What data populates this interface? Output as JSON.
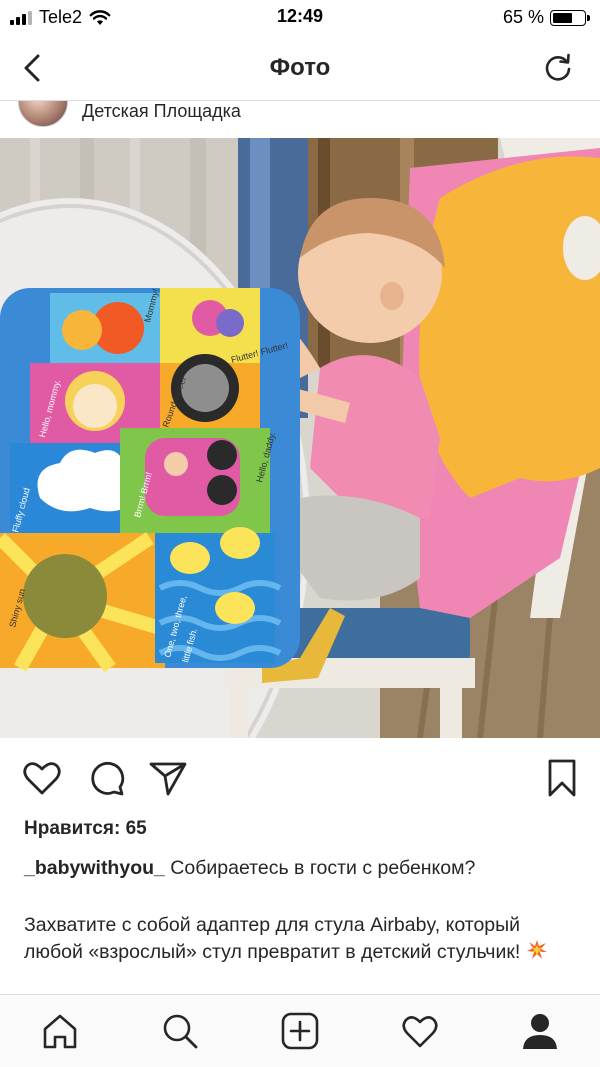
{
  "status_bar": {
    "carrier": "Tele2",
    "time": "12:49",
    "battery_text": "65 %",
    "battery_level": 0.65,
    "icons": [
      "signal-icon",
      "wifi-icon",
      "battery-icon"
    ]
  },
  "header": {
    "title": "Фото",
    "back_icon": "chevron-left-icon",
    "refresh_icon": "refresh-icon"
  },
  "post": {
    "location": "Детская Площадка",
    "likes_text": "Нравится: 65",
    "username": "_babywithyou_",
    "caption_first": "Собираетесь в гости с ребенком?",
    "caption_body": "Захватите с собой адаптер для стула Airbaby, который любой «взрослый» стул превратит в детский стульчик!",
    "caption_emoji": "collision-emoji"
  },
  "photo": {
    "book_texts": {
      "mommy": "Mommy!",
      "flutter": "Flutter! Flutter!",
      "hello_mommy": "Hello, mommy.",
      "round_wheel": "Round wheel",
      "fluffy_cloud": "Fluffy cloud",
      "brrm": "Brrm! Brrm!",
      "hello_daddy": "Hello, daddy.",
      "shiny_sun": "Shiny sun",
      "one_two_three": "One, two, three,",
      "little_fish": "little fish."
    }
  },
  "actions": {
    "icons": [
      "heart-icon",
      "comment-icon",
      "share-icon",
      "bookmark-icon"
    ]
  },
  "tabbar": {
    "icons": [
      "home-icon",
      "search-icon",
      "add-post-icon",
      "activity-heart-icon",
      "profile-icon"
    ]
  }
}
